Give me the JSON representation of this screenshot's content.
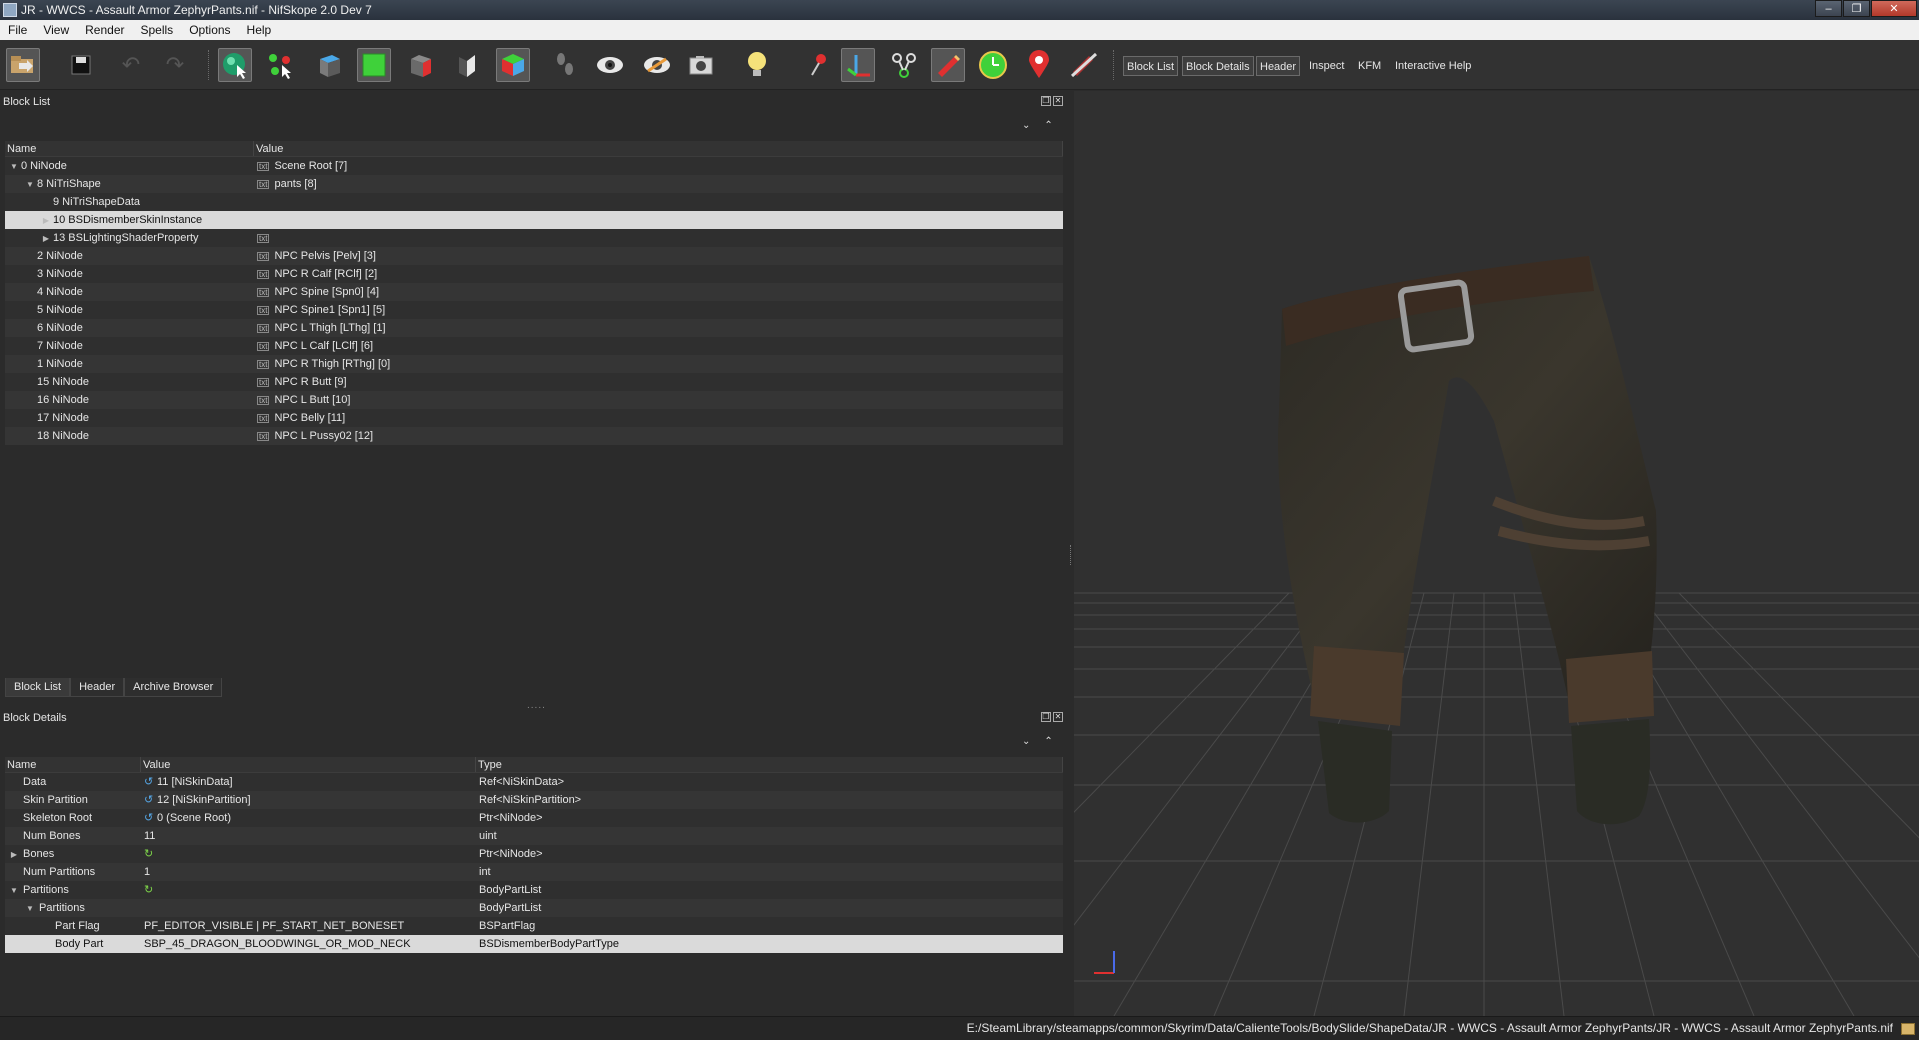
{
  "window": {
    "title": "JR - WWCS - Assault Armor ZephyrPants.nif - NifSkope 2.0 Dev 7",
    "minimize": "–",
    "restore": "❐",
    "close": "✕"
  },
  "menu": [
    "File",
    "View",
    "Render",
    "Spells",
    "Options",
    "Help"
  ],
  "toolbar": {
    "buttons": [
      "load-icon",
      "save-icon",
      "undo-icon",
      "redo-icon",
      "select-object-icon",
      "select-vertex-icon",
      "view-top-icon",
      "view-front-icon",
      "view-side-icon",
      "view-flip-icon",
      "view-free-icon",
      "walk-icon",
      "visibility-icon",
      "hidden-icon",
      "screenshot-icon",
      "light-icon",
      "pin-icon",
      "axes-icon",
      "nodes-icon",
      "marker-icon",
      "timer-icon",
      "location-icon",
      "disable-icon"
    ],
    "dock_toggles": [
      "Block List",
      "Block Details",
      "Header",
      "Inspect",
      "KFM",
      "Interactive Help"
    ]
  },
  "block_list": {
    "title": "Block List",
    "columns": [
      "Name",
      "Value"
    ],
    "rows": [
      {
        "name": "0 NiNode",
        "value": "Scene Root [7]",
        "indent": 0,
        "expander": "open"
      },
      {
        "name": "8 NiTriShape",
        "value": "pants [8]",
        "indent": 1,
        "expander": "open"
      },
      {
        "name": "9 NiTriShapeData",
        "value": "",
        "indent": 2,
        "expander": ""
      },
      {
        "name": "10 BSDismemberSkinInstance",
        "value": "",
        "indent": 2,
        "expander": "closed",
        "selected": true
      },
      {
        "name": "13 BSLightingShaderProperty",
        "value": "",
        "indent": 2,
        "expander": "closed",
        "icon_only": true
      },
      {
        "name": "2 NiNode",
        "value": "NPC Pelvis [Pelv] [3]",
        "indent": 1,
        "expander": ""
      },
      {
        "name": "3 NiNode",
        "value": "NPC R Calf [RClf] [2]",
        "indent": 1,
        "expander": ""
      },
      {
        "name": "4 NiNode",
        "value": "NPC Spine [Spn0] [4]",
        "indent": 1,
        "expander": ""
      },
      {
        "name": "5 NiNode",
        "value": "NPC Spine1 [Spn1] [5]",
        "indent": 1,
        "expander": ""
      },
      {
        "name": "6 NiNode",
        "value": "NPC L Thigh [LThg] [1]",
        "indent": 1,
        "expander": ""
      },
      {
        "name": "7 NiNode",
        "value": "NPC L Calf [LClf] [6]",
        "indent": 1,
        "expander": ""
      },
      {
        "name": "1 NiNode",
        "value": "NPC R Thigh [RThg] [0]",
        "indent": 1,
        "expander": ""
      },
      {
        "name": "15 NiNode",
        "value": "NPC R Butt [9]",
        "indent": 1,
        "expander": ""
      },
      {
        "name": "16 NiNode",
        "value": "NPC L Butt [10]",
        "indent": 1,
        "expander": ""
      },
      {
        "name": "17 NiNode",
        "value": "NPC Belly [11]",
        "indent": 1,
        "expander": ""
      },
      {
        "name": "18 NiNode",
        "value": "NPC L Pussy02 [12]",
        "indent": 1,
        "expander": ""
      }
    ]
  },
  "bottom_tabs": [
    "Block List",
    "Header",
    "Archive Browser"
  ],
  "block_details": {
    "title": "Block Details",
    "columns": [
      "Name",
      "Value",
      "Type"
    ],
    "rows": [
      {
        "name": "Data",
        "value": "11 [NiSkinData]",
        "type": "Ref<NiSkinData>",
        "indent": 1,
        "icon": "ref",
        "expander": ""
      },
      {
        "name": "Skin Partition",
        "value": "12 [NiSkinPartition]",
        "type": "Ref<NiSkinPartition>",
        "indent": 1,
        "icon": "ref",
        "expander": ""
      },
      {
        "name": "Skeleton Root",
        "value": "0 (Scene Root)",
        "type": "Ptr<NiNode>",
        "indent": 1,
        "icon": "ref",
        "expander": ""
      },
      {
        "name": "Num Bones",
        "value": "11",
        "type": "uint",
        "indent": 1,
        "icon": "",
        "expander": ""
      },
      {
        "name": "Bones",
        "value": "",
        "type": "Ptr<NiNode>",
        "indent": 1,
        "icon": "array",
        "expander": "closed"
      },
      {
        "name": "Num Partitions",
        "value": "1",
        "type": "int",
        "indent": 1,
        "icon": "",
        "expander": ""
      },
      {
        "name": "Partitions",
        "value": "",
        "type": "BodyPartList",
        "indent": 1,
        "icon": "array",
        "expander": "open"
      },
      {
        "name": "Partitions",
        "value": "",
        "type": "BodyPartList",
        "indent": 2,
        "icon": "",
        "expander": "open"
      },
      {
        "name": "Part Flag",
        "value": "PF_EDITOR_VISIBLE | PF_START_NET_BONESET",
        "type": "BSPartFlag",
        "indent": 3,
        "icon": "",
        "expander": ""
      },
      {
        "name": "Body Part",
        "value": "SBP_45_DRAGON_BLOODWINGL_OR_MOD_NECK",
        "type": "BSDismemberBodyPartType",
        "indent": 3,
        "icon": "",
        "expander": "",
        "selected": true
      }
    ]
  },
  "status": {
    "path": "E:/SteamLibrary/steamapps/common/Skyrim/Data/CalienteTools/BodySlide/ShapeData/JR - WWCS - Assault Armor ZephyrPants/JR - WWCS - Assault Armor ZephyrPants.nif"
  },
  "colors": {
    "accent_green": "#3fd13a",
    "ref_blue": "#56a8e8",
    "selection": "#dadada"
  }
}
